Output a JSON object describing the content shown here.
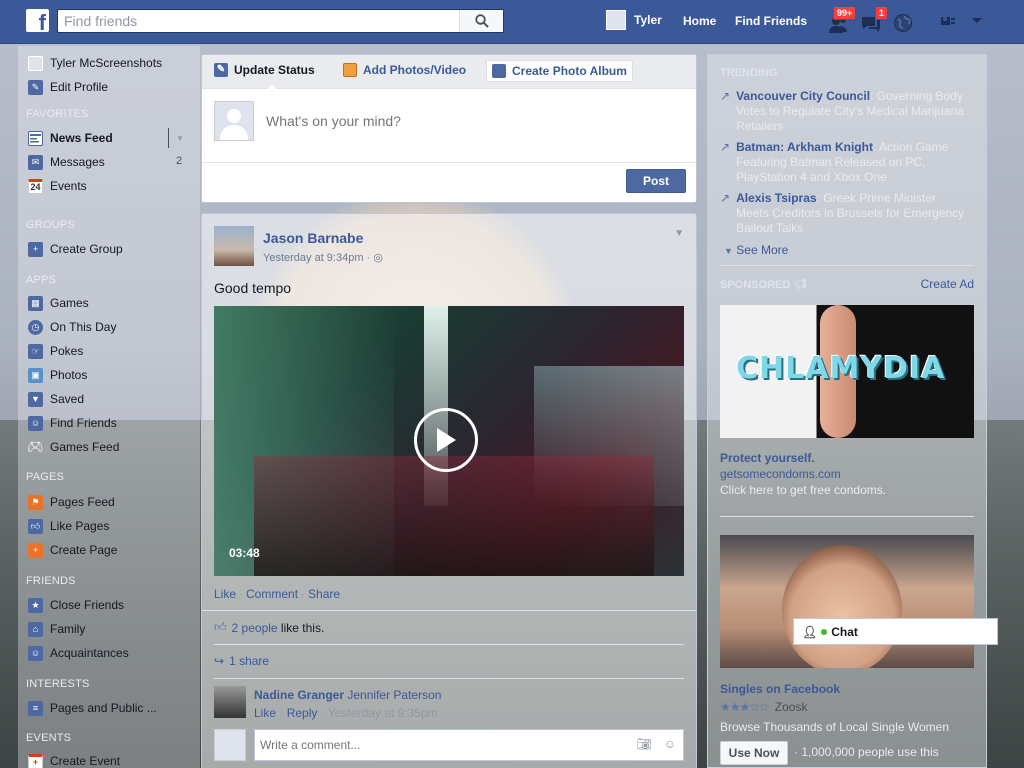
{
  "header": {
    "logo": "f",
    "search_placeholder": "Find friends",
    "user_name": "Tyler",
    "home_label": "Home",
    "find_friends_label": "Find Friends",
    "friend_requests_badge": "99+",
    "messages_badge": "1"
  },
  "sidebar": {
    "profile_name": "Tyler McScreenshots",
    "edit_profile": "Edit Profile",
    "sections": {
      "favorites": "FAVORITES",
      "groups": "GROUPS",
      "apps": "APPS",
      "pages": "PAGES",
      "friends": "FRIENDS",
      "interests": "INTERESTS",
      "events": "EVENTS"
    },
    "favorites": {
      "news_feed": "News Feed",
      "messages": "Messages",
      "messages_count": "2",
      "events": "Events",
      "events_icon_text": "24"
    },
    "groups": {
      "create_group": "Create Group"
    },
    "apps": {
      "games": "Games",
      "on_this_day": "On This Day",
      "pokes": "Pokes",
      "photos": "Photos",
      "saved": "Saved",
      "find_friends": "Find Friends",
      "games_feed": "Games Feed"
    },
    "pages": {
      "pages_feed": "Pages Feed",
      "like_pages": "Like Pages",
      "create_page": "Create Page"
    },
    "friends": {
      "close_friends": "Close Friends",
      "family": "Family",
      "acquaintances": "Acquaintances"
    },
    "interests": {
      "pages_public": "Pages and Public ..."
    },
    "events": {
      "create_event": "Create Event"
    }
  },
  "composer": {
    "tab_update_status": "Update Status",
    "tab_add_photos": "Add Photos/Video",
    "tab_create_album": "Create Photo Album",
    "placeholder": "What's on your mind?",
    "post_button": "Post"
  },
  "post": {
    "author": "Jason Barnabe",
    "time": "Yesterday at 9:34pm · ",
    "text": "Good tempo",
    "video_duration": "03:48",
    "actions": {
      "like": "Like",
      "comment": "Comment",
      "share": "Share"
    },
    "likes_link": "2 people",
    "likes_suffix": " like this.",
    "shares": "1 share",
    "comment": {
      "author": "Nadine Granger",
      "mention": "Jennifer Paterson",
      "like": "Like",
      "reply": "Reply",
      "time": "Yesterday at 9:35pm"
    },
    "write_comment_placeholder": "Write a comment..."
  },
  "right": {
    "trending_header": "TRENDING",
    "trends": [
      {
        "title": "Vancouver City Council",
        "desc": ": Governing Body Votes to Regulate City's Medical Marijuana Retailers"
      },
      {
        "title": "Batman: Arkham Knight",
        "desc": ": Action Game Featuring Batman Released on PC, PlayStation 4 and Xbox One"
      },
      {
        "title": "Alexis Tsipras",
        "desc": ": Greek Prime Minister Meets Creditors in Brussels for Emergency Bailout Talks"
      }
    ],
    "see_more": "See More",
    "sponsored_header": "SPONSORED",
    "create_ad": "Create Ad",
    "ad1": {
      "image_text": "CHLAMYDIA",
      "title": "Protect yourself.",
      "link": "getsomecondoms.com",
      "desc": "Click here to get free condoms."
    },
    "ad2": {
      "title": "Singles on Facebook",
      "stars": "★★★☆☆",
      "brand": "Zoosk",
      "desc": "Browse Thousands of Local Single Women",
      "button": "Use Now",
      "count": "· 1,000,000 people use this"
    },
    "chat_label": "Chat"
  }
}
